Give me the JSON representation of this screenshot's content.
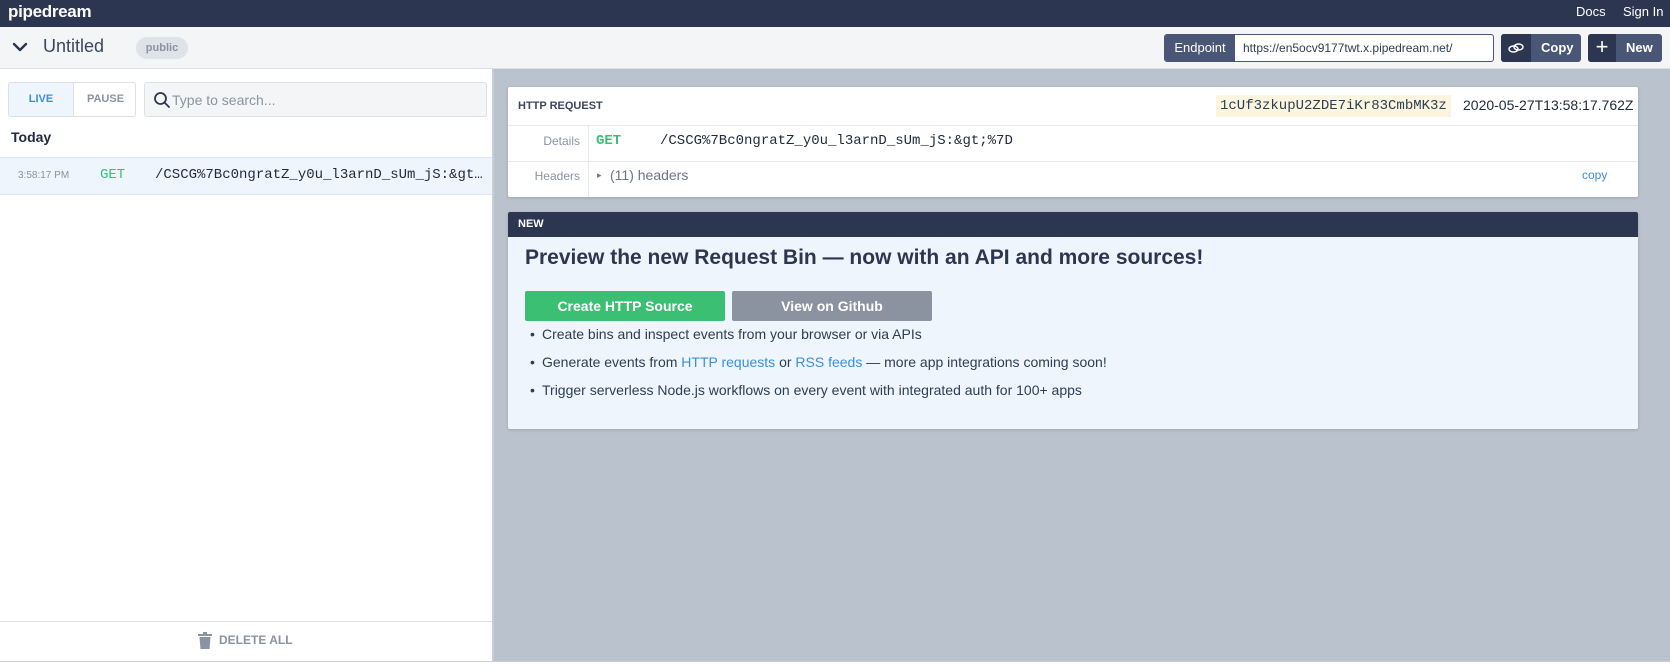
{
  "topbar": {
    "logo": "pipedream",
    "docs": "Docs",
    "sign_in": "Sign In"
  },
  "bin": {
    "title": "Untitled",
    "visibility": "public",
    "endpoint_label": "Endpoint",
    "endpoint_url": "https://en5ocv9177twt.x.pipedream.net/",
    "copy_label": "Copy",
    "new_label": "New"
  },
  "left": {
    "live": "LIVE",
    "pause": "PAUSE",
    "search_placeholder": "Type to search...",
    "group": "Today",
    "events": [
      {
        "time": "3:58:17 PM",
        "method": "GET",
        "path": "/CSCG%7Bc0ngratZ_y0u_l3arnD_sUm_jS:&gt;%7D"
      }
    ],
    "delete_all": "DELETE ALL"
  },
  "request": {
    "title": "HTTP REQUEST",
    "id": "1cUf3zkupU2ZDE7iKr83CmbMK3z",
    "timestamp": "2020-05-27T13:58:17.762Z",
    "details_label": "Details",
    "method": "GET",
    "path": "/CSCG%7Bc0ngratZ_y0u_l3arnD_sUm_jS:&gt;%7D",
    "headers_label": "Headers",
    "headers_summary": "(11) headers",
    "copy": "copy"
  },
  "promo": {
    "tag": "NEW",
    "title": "Preview the new Request Bin — now with an API and more sources!",
    "create_button": "Create HTTP Source",
    "github_button": "View on Github",
    "bullet1": "Create bins and inspect events from your browser or via APIs",
    "bullet2_pre": "Generate events from ",
    "bullet2_link1": "HTTP requests",
    "bullet2_mid": " or ",
    "bullet2_link2": "RSS feeds",
    "bullet2_post": " — more app integrations coming soon!",
    "bullet3": "Trigger serverless Node.js workflows on every event with integrated auth for 100+ apps"
  },
  "icons": {
    "chevron": "chevron-down-icon",
    "link": "link-icon",
    "plus": "plus-icon",
    "search": "search-icon",
    "trash": "trash-icon",
    "expand": "triangle-right-icon"
  },
  "colors": {
    "nav_dark": "#2c3650",
    "accent_blue": "#3b8fd9",
    "method_green": "#3bbf72",
    "panel_gray": "#b9c2cd"
  }
}
